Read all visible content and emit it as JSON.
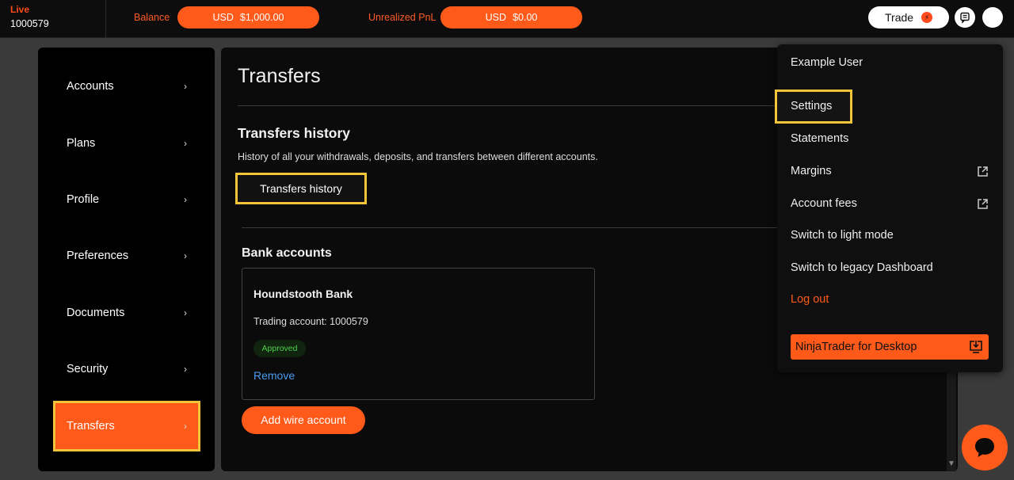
{
  "header": {
    "mode": "Live",
    "account_number": "1000579",
    "balance_label": "Balance",
    "balance_currency": "USD",
    "balance_value": "$1,000.00",
    "pnl_label": "Unrealized PnL",
    "pnl_currency": "USD",
    "pnl_value": "$0.00",
    "trade_label": "Trade"
  },
  "sidebar": {
    "items": [
      {
        "label": "Accounts"
      },
      {
        "label": "Plans"
      },
      {
        "label": "Profile"
      },
      {
        "label": "Preferences"
      },
      {
        "label": "Documents"
      },
      {
        "label": "Security"
      },
      {
        "label": "Transfers",
        "active": true
      }
    ]
  },
  "main": {
    "title": "Transfers",
    "history": {
      "title": "Transfers history",
      "description": "History of all your withdrawals, deposits, and transfers between different accounts.",
      "button_label": "Transfers history"
    },
    "bank": {
      "title": "Bank accounts",
      "name": "Houndstooth Bank",
      "trading_account": "Trading account: 1000579",
      "status": "Approved",
      "remove_label": "Remove",
      "add_label": "Add wire account"
    }
  },
  "menu": {
    "user": "Example User",
    "settings": "Settings",
    "statements": "Statements",
    "margins": "Margins",
    "account_fees": "Account fees",
    "light_mode": "Switch to light mode",
    "legacy": "Switch to legacy Dashboard",
    "logout": "Log out",
    "desktop": "NinjaTrader for Desktop"
  },
  "colors": {
    "accent": "#ff5a1a",
    "highlight": "#f3c33a",
    "approved": "#4bd24b",
    "link": "#4a9bf0"
  }
}
